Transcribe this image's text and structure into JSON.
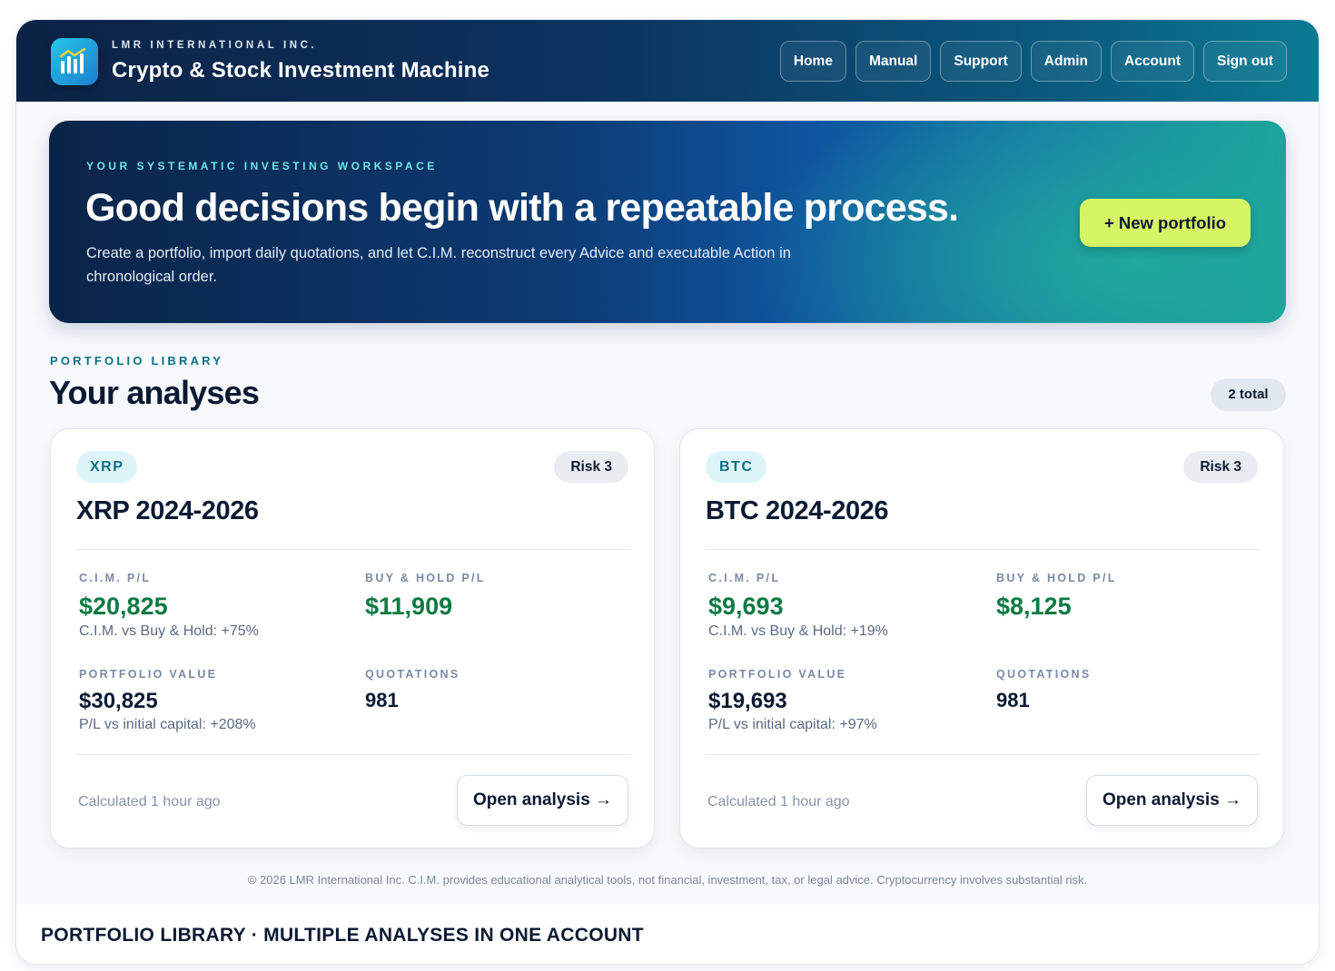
{
  "header": {
    "logo_icon": "bar-chart-icon",
    "company": "LMR INTERNATIONAL INC.",
    "app_title": "Crypto & Stock Investment Machine",
    "nav": [
      "Home",
      "Manual",
      "Support",
      "Admin",
      "Account",
      "Sign out"
    ]
  },
  "hero": {
    "kicker": "YOUR SYSTEMATIC INVESTING WORKSPACE",
    "title": "Good decisions begin with a repeatable process.",
    "description": "Create a portfolio, import daily quotations, and let C.I.M. reconstruct every Advice and executable Action in chronological order.",
    "cta_label": "+  New portfolio"
  },
  "library": {
    "kicker": "PORTFOLIO LIBRARY",
    "title": "Your analyses",
    "total_label": "2 total"
  },
  "cards": [
    {
      "ticker": "XRP",
      "risk": "Risk 3",
      "title": "XRP 2024-2026",
      "cim_pl_label": "C.I.M. P/L",
      "cim_pl_value": "$20,825",
      "cim_vs_bh": "C.I.M. vs Buy & Hold: +75%",
      "bh_pl_label": "BUY & HOLD P/L",
      "bh_pl_value": "$11,909",
      "pv_label": "PORTFOLIO VALUE",
      "pv_value": "$30,825",
      "pv_note": "P/L vs initial capital: +208%",
      "quotes_label": "QUOTATIONS",
      "quotes_value": "981",
      "calculated": "Calculated 1 hour ago",
      "open_label": "Open analysis →"
    },
    {
      "ticker": "BTC",
      "risk": "Risk 3",
      "title": "BTC 2024-2026",
      "cim_pl_label": "C.I.M. P/L",
      "cim_pl_value": "$9,693",
      "cim_vs_bh": "C.I.M. vs Buy & Hold: +19%",
      "bh_pl_label": "BUY & HOLD P/L",
      "bh_pl_value": "$8,125",
      "pv_label": "PORTFOLIO VALUE",
      "pv_value": "$19,693",
      "pv_note": "P/L vs initial capital: +97%",
      "quotes_label": "QUOTATIONS",
      "quotes_value": "981",
      "calculated": "Calculated 1 hour ago",
      "open_label": "Open analysis →"
    }
  ],
  "footer": {
    "disclaimer": "© 2026 LMR International Inc. C.I.M. provides educational analytical tools, not financial, investment, tax, or legal advice. Cryptocurrency involves substantial risk.",
    "caption": "PORTFOLIO LIBRARY · MULTIPLE ANALYSES IN ONE ACCOUNT"
  },
  "colors": {
    "accent_lime": "#d6f565",
    "positive_green": "#0d7a43",
    "teal": "#0e6f86",
    "navy": "#0b1a33"
  }
}
